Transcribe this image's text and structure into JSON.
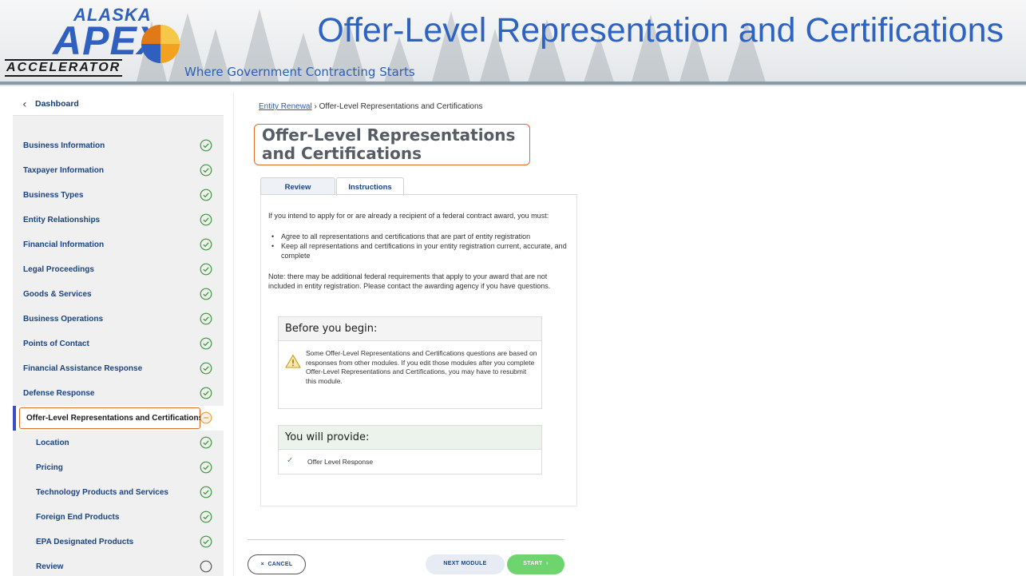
{
  "slide": {
    "logo": {
      "line1": "ALASKA",
      "line2": "APEX",
      "line3": "ACCELERATOR"
    },
    "tagline": "Where Government Contracting Starts",
    "title": "Offer-Level Representation and Certifications"
  },
  "sidebar": {
    "back_label": "Dashboard",
    "items": [
      {
        "label": "Business Information",
        "status": "complete"
      },
      {
        "label": "Taxpayer Information",
        "status": "complete"
      },
      {
        "label": "Business Types",
        "status": "complete"
      },
      {
        "label": "Entity Relationships",
        "status": "complete"
      },
      {
        "label": "Financial Information",
        "status": "complete"
      },
      {
        "label": "Legal Proceedings",
        "status": "complete"
      },
      {
        "label": "Goods & Services",
        "status": "complete"
      },
      {
        "label": "Business Operations",
        "status": "complete"
      },
      {
        "label": "Points of Contact",
        "status": "complete"
      },
      {
        "label": "Financial Assistance Response",
        "status": "complete"
      },
      {
        "label": "Defense Response",
        "status": "complete"
      },
      {
        "label": "Offer-Level Representations and Certifications",
        "status": "in-progress"
      },
      {
        "label": "Location",
        "status": "complete"
      },
      {
        "label": "Pricing",
        "status": "complete"
      },
      {
        "label": "Technology Products and Services",
        "status": "complete"
      },
      {
        "label": "Foreign End Products",
        "status": "complete"
      },
      {
        "label": "EPA Designated Products",
        "status": "complete"
      },
      {
        "label": "Review",
        "status": "not-started"
      }
    ]
  },
  "breadcrumb": {
    "link": "Entity Renewal",
    "separator": " › ",
    "current": "Offer-Level Representations and Certifications"
  },
  "page_title": "Offer-Level Representations and Certifications",
  "tabs": {
    "review": "Review",
    "instructions": "Instructions"
  },
  "instructions": {
    "intro": "If you intend to apply for or are already a recipient of a federal contract award, you must:",
    "bullets": [
      "Agree to all representations and certifications that are part of entity registration",
      "Keep all representations and certifications in your entity registration current, accurate, and complete"
    ],
    "note": "Note: there may be additional federal requirements that apply to your award that are not included in entity registration. Please contact the awarding agency if you have questions."
  },
  "before_begin": {
    "heading": "Before you begin:",
    "text": "Some Offer-Level Representations and Certifications questions are based on responses from other modules. If you edit those modules after you complete Offer-Level Representations and Certifications, you may have to resubmit this module."
  },
  "provide": {
    "heading": "You will provide:",
    "item": "Offer Level Response"
  },
  "footer": {
    "cancel": "CANCEL",
    "next": "NEXT MODULE",
    "start": "START",
    "cancel_icon": "×",
    "start_icon": "›"
  },
  "colors": {
    "accent_blue": "#2d63c2",
    "nav_link": "#1a4480",
    "highlight": "#e06c2a",
    "complete_green": "#3d9a3d",
    "start_green": "#6ed46e"
  }
}
